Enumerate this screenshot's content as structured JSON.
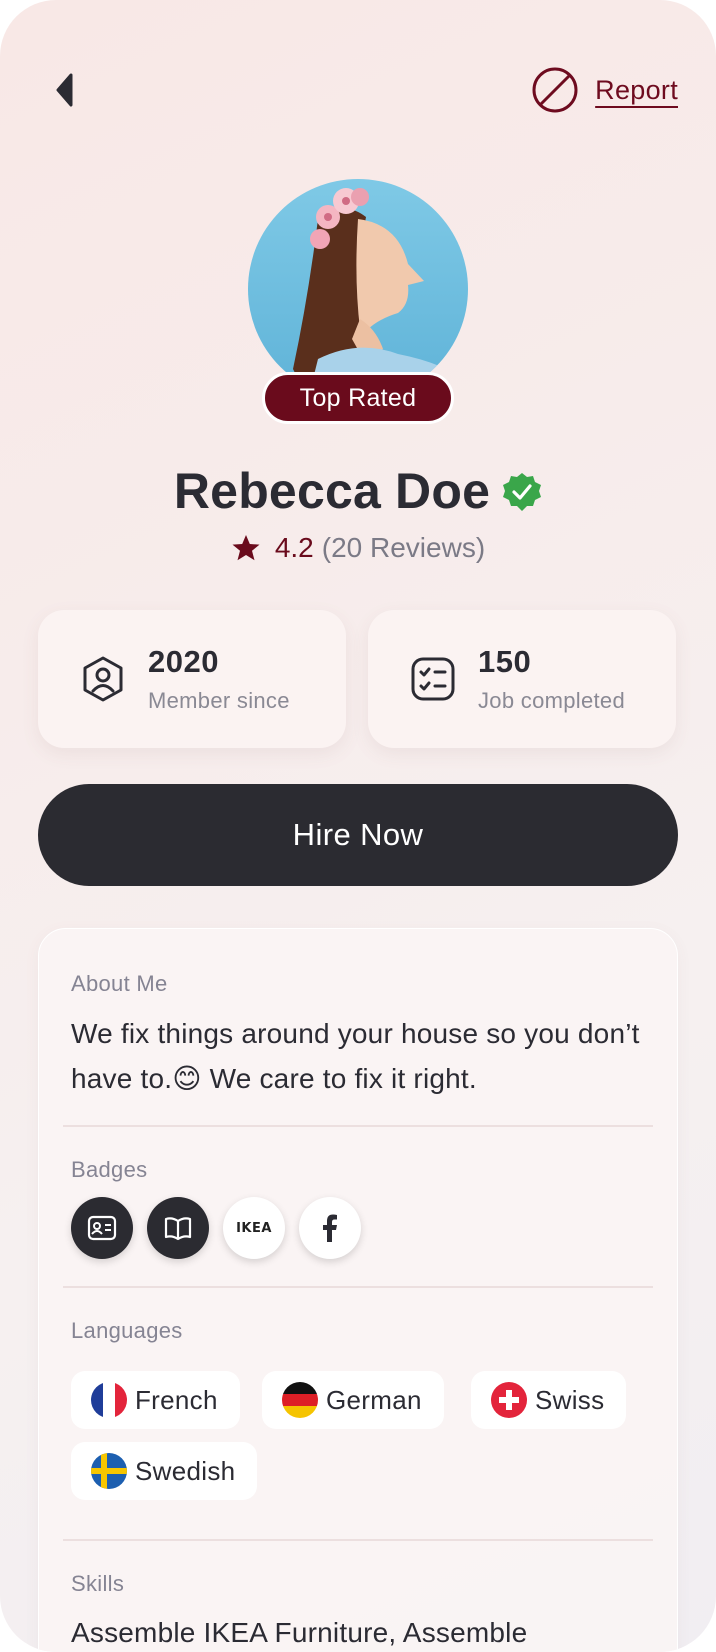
{
  "header": {
    "report_label": "Report"
  },
  "profile": {
    "badge_label": "Top Rated",
    "name": "Rebecca Doe",
    "rating": "4.2",
    "reviews": "(20 Reviews)"
  },
  "stats": [
    {
      "value": "2020",
      "label": "Member since",
      "icon": "user-badge-icon"
    },
    {
      "value": "150",
      "label": "Job completed",
      "icon": "checklist-icon"
    }
  ],
  "hire_button_label": "Hire Now",
  "about": {
    "label": "About Me",
    "text_part1": "We fix things around your house so you don’t have to.",
    "emoji": "😊",
    "text_part2": " We care to fix it right."
  },
  "badges": {
    "label": "Badges",
    "items": [
      {
        "name": "id-card-badge-icon"
      },
      {
        "name": "book-badge-icon"
      },
      {
        "name": "ikea-badge-icon",
        "text": "IKEA"
      },
      {
        "name": "facebook-badge-icon"
      }
    ]
  },
  "languages": {
    "label": "Languages",
    "items": [
      "French",
      "German",
      "Swiss",
      "Swedish"
    ]
  },
  "skills": {
    "label": "Skills",
    "text": "Assemble IKEA Furniture, Assemble"
  },
  "colors": {
    "accent": "#6a0b1c",
    "dark_button": "#2b2b31",
    "verified": "#3aa64a"
  }
}
